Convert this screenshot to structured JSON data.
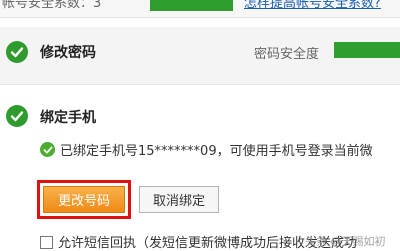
{
  "top": {
    "score_label": "帐号安全系数：3",
    "improve_link": "怎样提高帐号安全系数?",
    "score_bar_color": "#2e9e2e"
  },
  "password_section": {
    "title": "修改密码",
    "strength_label": "密码安全度",
    "check_icon": "check-circle-icon",
    "status_color": "#2f9b2f"
  },
  "phone_section": {
    "title": "绑定手机",
    "bound_message": "已绑定手机号15*******09，可使用手机号登录当前微",
    "change_button": "更改号码",
    "unbind_button": "取消绑定",
    "highlight_color": "#e01010",
    "primary_button_color": "#f08a16"
  },
  "sms": {
    "checkbox_label": "允许短信回执（发短信更新微博成功后接收发送成功",
    "checked": false
  },
  "watermark": "头条 @天赐如初"
}
